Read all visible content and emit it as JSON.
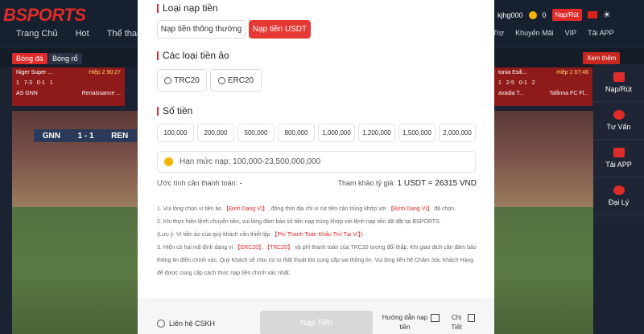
{
  "site": {
    "logo": "BSPORTS",
    "nav": [
      "Trang Chủ",
      "Hot",
      "Thể thao"
    ],
    "right_nav": [
      "Trợ",
      "Khuyến Mãi",
      "VIP",
      "Tải APP"
    ],
    "user": "kjhg000",
    "balance": "0",
    "deposit_label": "Nạp/Rút",
    "sport_tabs": [
      "Bóng đá",
      "Bóng rổ"
    ],
    "more_label": "Xem thêm",
    "matches": [
      {
        "league": "Niger Super ...",
        "status": "Hiệp 2 90:27",
        "home": "AS GNN",
        "away": "Renaissance ...",
        "home_score": "1",
        "away_score": "1",
        "c1": "7-3",
        "c2": "0-1"
      },
      {
        "league": "tonia Esili...",
        "status": "Hiệp 2 67:46",
        "home": "avadia T...",
        "away": "Tallinna FC Fl...",
        "home_score": "1",
        "away_score": "2",
        "c1": "2-5",
        "c2": "0-1"
      }
    ],
    "score_overlay": {
      "home": "GNN",
      "score": "1 - 1",
      "away": "REN"
    },
    "side_menu": [
      "Nạp/Rút",
      "Tư Vấn",
      "Tải APP",
      "Đại Lý"
    ]
  },
  "modal": {
    "sec_type": "Loại nạp tiền",
    "tabs": [
      "Nạp tiền thông thường",
      "Nạp tiền USDT"
    ],
    "sec_coin": "Các loại tiền ảo",
    "coins": [
      "TRC20",
      "ERC20"
    ],
    "sec_amount": "Số tiền",
    "amounts": [
      "100,000",
      "200,000",
      "500,000",
      "800,000",
      "1,000,000",
      "1,200,000",
      "1,500,000",
      "2,000,000"
    ],
    "placeholder": "Hạn mức nạp: 100,000-23,500,000,000",
    "est_label": "Ước tính cần thanh toán:",
    "est_value": "-",
    "rate_label": "Tham khảo tỷ giá:",
    "rate_value": "1 USDT = 26315 VND",
    "notes": {
      "n1a": "1. Vui lòng chọn ví tiền ảo ",
      "n1b": "【Định Dạng Ví】",
      "n1c": ", đồng thời địa chỉ ví rút tiền cần trùng khớp với ",
      "n1d": "【Định Dạng Ví】",
      "n1e": " đã chọn.",
      "n2a": "2. Khi thực hiện lệnh chuyển tiền, vui lòng đảm bảo số tiền nạp trùng khớp với lệnh nạp tiền đã đặt tại BSPORTS.",
      "n2b": "(Lưu ý: Ví tiền ảo của quý khách cần thiết lập ",
      "n2c": "【Phí Thanh Toán Khấu Trừ Tại Ví】",
      "n2d": ")",
      "n3a": "3. Hiện có hai mã định dạng ví ",
      "n3b": "【ERC20】",
      "n3c": "、",
      "n3d": "【TRC20】",
      "n3e": " và phí thanh toán của TRC20 tương đối thấp. Khi giao dịch cần đảm bảo thông tin điền chính xác, Quý Khách sẽ chịu rủi ro thất thoát khi cung cấp sai thông tin. Vui lòng liên hệ Chăm Sóc Khách Hàng để được cung cấp cách thức nạp tiền chính xác nhất."
    },
    "footer": {
      "cskh": "Liên hệ CSKH",
      "submit": "Nạp Tiền",
      "guide": "Hướng dẫn nạp tiền",
      "detail": "Chi Tiết"
    }
  },
  "colors": {
    "accent": "#e53935",
    "disabled": "#d8d8d8"
  }
}
